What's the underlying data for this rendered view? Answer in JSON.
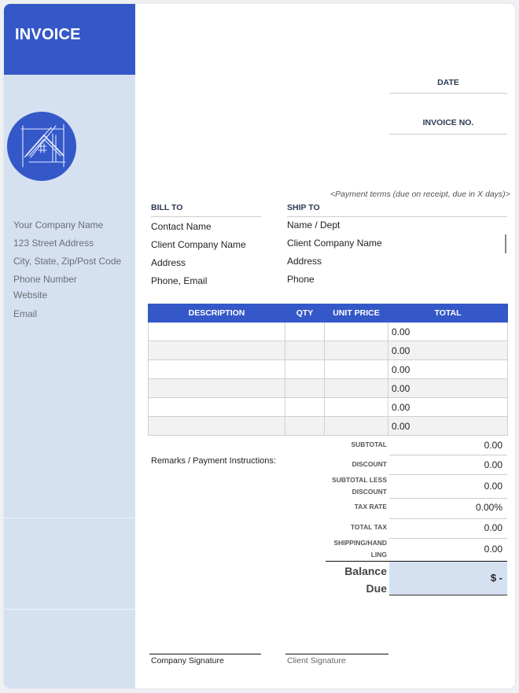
{
  "sidebar": {
    "title": "INVOICE",
    "logo_icon": "house-blueprint-icon",
    "company": {
      "name": "Your Company Name",
      "street": "123 Street Address",
      "city": "City, State, Zip/Post Code",
      "phone": "Phone Number",
      "website": "Website",
      "email": "Email"
    }
  },
  "meta": {
    "date_label": "DATE",
    "date_value": "",
    "invoice_no_label": "INVOICE NO.",
    "invoice_no_value": "",
    "payment_terms": "<Payment terms (due on receipt, due in X days)>"
  },
  "bill_to": {
    "label": "BILL TO",
    "lines": [
      "Contact Name",
      "Client Company Name",
      "Address",
      "Phone, Email"
    ]
  },
  "ship_to": {
    "label": "SHIP TO",
    "lines": [
      "Name / Dept",
      "Client Company Name",
      "Address",
      "Phone"
    ]
  },
  "items": {
    "headers": [
      "DESCRIPTION",
      "QTY",
      "UNIT PRICE",
      "TOTAL"
    ],
    "rows": [
      {
        "description": "",
        "qty": "",
        "unit_price": "",
        "total": "0.00"
      },
      {
        "description": "",
        "qty": "",
        "unit_price": "",
        "total": "0.00"
      },
      {
        "description": "",
        "qty": "",
        "unit_price": "",
        "total": "0.00"
      },
      {
        "description": "",
        "qty": "",
        "unit_price": "",
        "total": "0.00"
      },
      {
        "description": "",
        "qty": "",
        "unit_price": "",
        "total": "0.00"
      },
      {
        "description": "",
        "qty": "",
        "unit_price": "",
        "total": "0.00"
      }
    ]
  },
  "remarks_label": "Remarks / Payment Instructions:",
  "totals": {
    "subtotal": {
      "label": "SUBTOTAL",
      "value": "0.00"
    },
    "discount": {
      "label": "DISCOUNT",
      "value": "0.00"
    },
    "subtotal_less_discount": {
      "label_1": "SUBTOTAL LESS",
      "label_2": "DISCOUNT",
      "value": "0.00"
    },
    "tax_rate": {
      "label": "TAX RATE",
      "value": "0.00%"
    },
    "total_tax": {
      "label": "TOTAL TAX",
      "value": "0.00"
    },
    "shipping": {
      "label_1": "SHIPPING/HAND",
      "label_2": "LING",
      "value": "0.00"
    },
    "balance_due": {
      "label_1": "Balance",
      "label_2": "Due",
      "value": "$ -"
    }
  },
  "signatures": {
    "company": "Company Signature",
    "client": "Client Signature"
  },
  "colors": {
    "brand_blue": "#3558c8",
    "sidebar_light": "#d5e1f1",
    "row_alt": "#f2f2f2"
  }
}
